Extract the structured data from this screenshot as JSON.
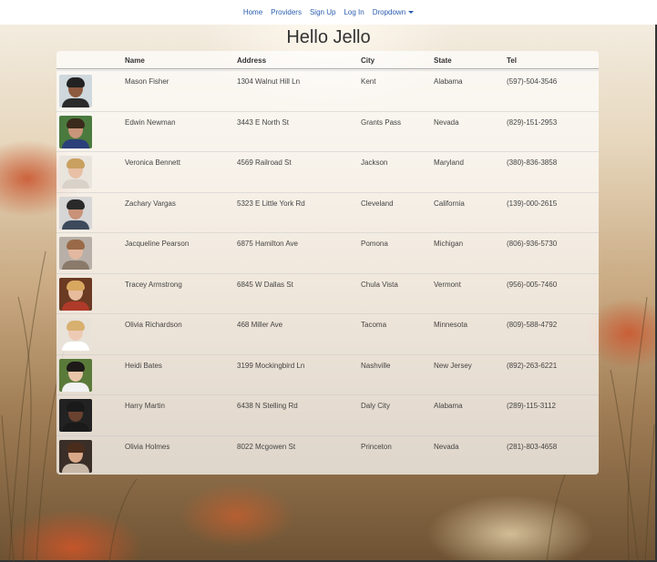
{
  "nav": {
    "home": "Home",
    "providers": "Providers",
    "signup": "Sign Up",
    "login": "Log In",
    "dropdown": "Dropdown"
  },
  "title": "Hello Jello",
  "table": {
    "headers": {
      "name": "Name",
      "address": "Address",
      "city": "City",
      "state": "State",
      "tel": "Tel"
    },
    "rows": [
      {
        "name": "Mason Fisher",
        "address": "1304 Walnut Hill Ln",
        "city": "Kent",
        "state": "Alabama",
        "tel": "(597)-504-3546"
      },
      {
        "name": "Edwin Newman",
        "address": "3443 E North St",
        "city": "Grants Pass",
        "state": "Nevada",
        "tel": "(829)-151-2953"
      },
      {
        "name": "Veronica Bennett",
        "address": "4569 Railroad St",
        "city": "Jackson",
        "state": "Maryland",
        "tel": "(380)-836-3858"
      },
      {
        "name": "Zachary Vargas",
        "address": "5323 E Little York Rd",
        "city": "Cleveland",
        "state": "California",
        "tel": "(139)-000-2615"
      },
      {
        "name": "Jacqueline Pearson",
        "address": "6875 Hamilton Ave",
        "city": "Pomona",
        "state": "Michigan",
        "tel": "(806)-936-5730"
      },
      {
        "name": "Tracey Armstrong",
        "address": "6845 W Dallas St",
        "city": "Chula Vista",
        "state": "Vermont",
        "tel": "(956)-005-7460"
      },
      {
        "name": "Olivia Richardson",
        "address": "468 Miller Ave",
        "city": "Tacoma",
        "state": "Minnesota",
        "tel": "(809)-588-4792"
      },
      {
        "name": "Heidi Bates",
        "address": "3199 Mockingbird Ln",
        "city": "Nashville",
        "state": "New Jersey",
        "tel": "(892)-263-6221"
      },
      {
        "name": "Harry Martin",
        "address": "6438 N Stelling Rd",
        "city": "Daly City",
        "state": "Alabama",
        "tel": "(289)-115-3112"
      },
      {
        "name": "Olivia Holmes",
        "address": "8022 Mcgowen St",
        "city": "Princeton",
        "state": "Nevada",
        "tel": "(281)-803-4658"
      }
    ]
  },
  "avatars": [
    {
      "bg": "#cfd8dc",
      "skin": "#8d5b3f",
      "hair": "#222222",
      "shirt": "#2b2b2b"
    },
    {
      "bg": "#4b7a3e",
      "skin": "#c9957a",
      "hair": "#3a2a1c",
      "shirt": "#2b3f7a"
    },
    {
      "bg": "#e9e4dc",
      "skin": "#e8c0a6",
      "hair": "#c8a060",
      "shirt": "#d9d2c8"
    },
    {
      "bg": "#d6d6d6",
      "skin": "#c89278",
      "hair": "#2a2a2a",
      "shirt": "#3c4a5c"
    },
    {
      "bg": "#b8b0a8",
      "skin": "#e2b9a0",
      "hair": "#9a6a48",
      "shirt": "#8a7a6a"
    },
    {
      "bg": "#6b3a22",
      "skin": "#e6bc9c",
      "hair": "#d8a860",
      "shirt": "#b03a2a"
    },
    {
      "bg": "#e8e2d8",
      "skin": "#eccab4",
      "hair": "#d8b070",
      "shirt": "#ffffff"
    },
    {
      "bg": "#5a7a3a",
      "skin": "#e8c4a8",
      "hair": "#1e1a18",
      "shirt": "#f2f2f2"
    },
    {
      "bg": "#222222",
      "skin": "#6a4230",
      "hair": "#1a1a1a",
      "shirt": "#1a1a1a"
    },
    {
      "bg": "#3a2e28",
      "skin": "#d9a888",
      "hair": "#4a2c1c",
      "shirt": "#c8b8a8"
    }
  ]
}
